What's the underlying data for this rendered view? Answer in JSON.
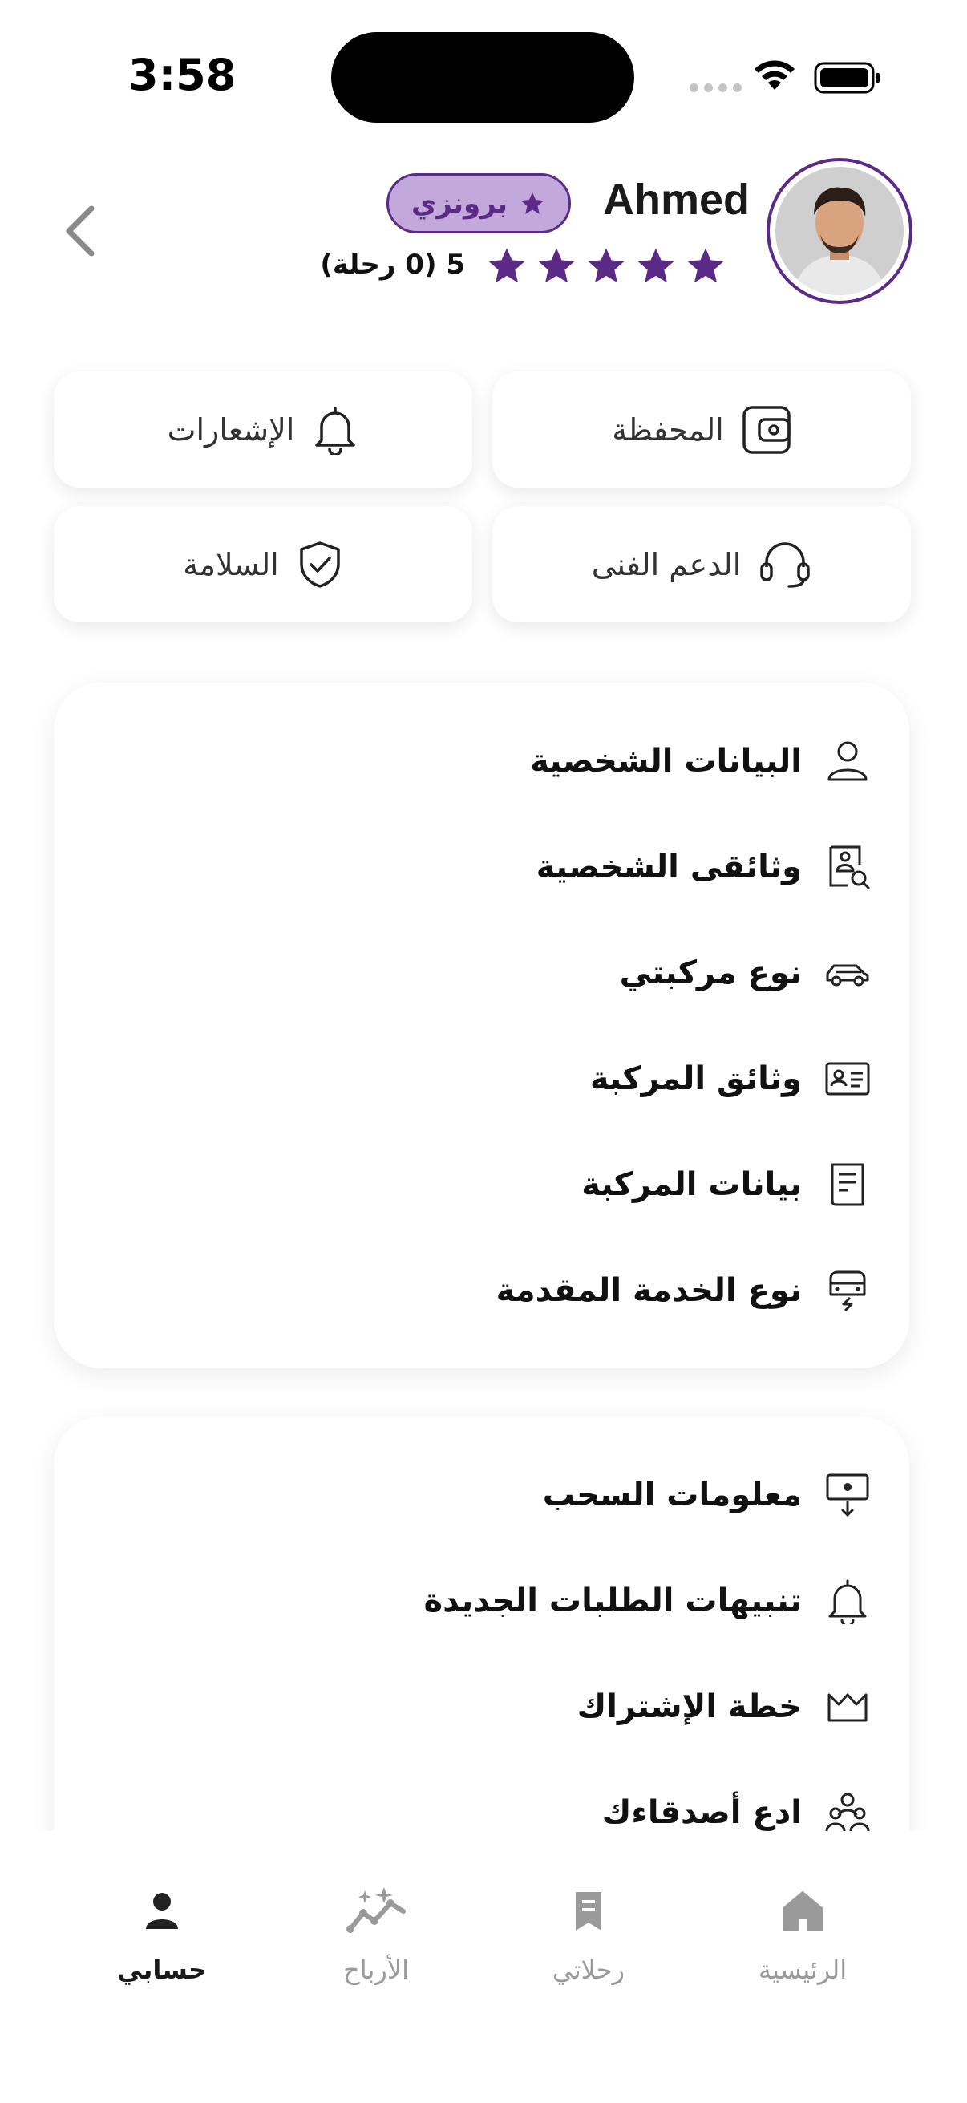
{
  "status_bar": {
    "time": "3:58"
  },
  "header": {
    "name": "Ahmed",
    "badge": "برونزي",
    "stars": 5,
    "rating_text": "5 (0 رحلة)"
  },
  "quick_tiles": [
    {
      "label": "المحفظة",
      "icon": "wallet-icon"
    },
    {
      "label": "الإشعارات",
      "icon": "bell-icon"
    },
    {
      "label": "الدعم الفنى",
      "icon": "headset-icon"
    },
    {
      "label": "السلامة",
      "icon": "shield-check-icon"
    }
  ],
  "menu_primary": [
    {
      "label": "البيانات الشخصية",
      "icon": "user-icon"
    },
    {
      "label": "وثائقى الشخصية",
      "icon": "document-search-icon"
    },
    {
      "label": "نوع مركبتي",
      "icon": "car-icon"
    },
    {
      "label": "وثائق المركبة",
      "icon": "id-card-icon"
    },
    {
      "label": "بيانات المركبة",
      "icon": "receipt-icon"
    },
    {
      "label": "نوع الخدمة المقدمة",
      "icon": "electric-car-icon"
    }
  ],
  "menu_secondary": [
    {
      "label": "معلومات السحب",
      "icon": "cash-withdraw-icon"
    },
    {
      "label": "تنبيهات الطلبات الجديدة",
      "icon": "bell-icon"
    },
    {
      "label": "خطة الإشتراك",
      "icon": "crown-icon"
    },
    {
      "label": "ادع أصدقاءك",
      "icon": "users-icon"
    }
  ],
  "bottom_nav": [
    {
      "label": "حسابي",
      "icon": "person-icon",
      "active": true
    },
    {
      "label": "الأرباح",
      "icon": "trend-sparkle-icon",
      "active": false
    },
    {
      "label": "رحلاتي",
      "icon": "trips-icon",
      "active": false
    },
    {
      "label": "الرئيسية",
      "icon": "home-icon",
      "active": false
    }
  ],
  "colors": {
    "brand_purple": "#5B2A86",
    "badge_fill": "#C3A8DC",
    "inactive_gray": "#9A9A9A"
  }
}
